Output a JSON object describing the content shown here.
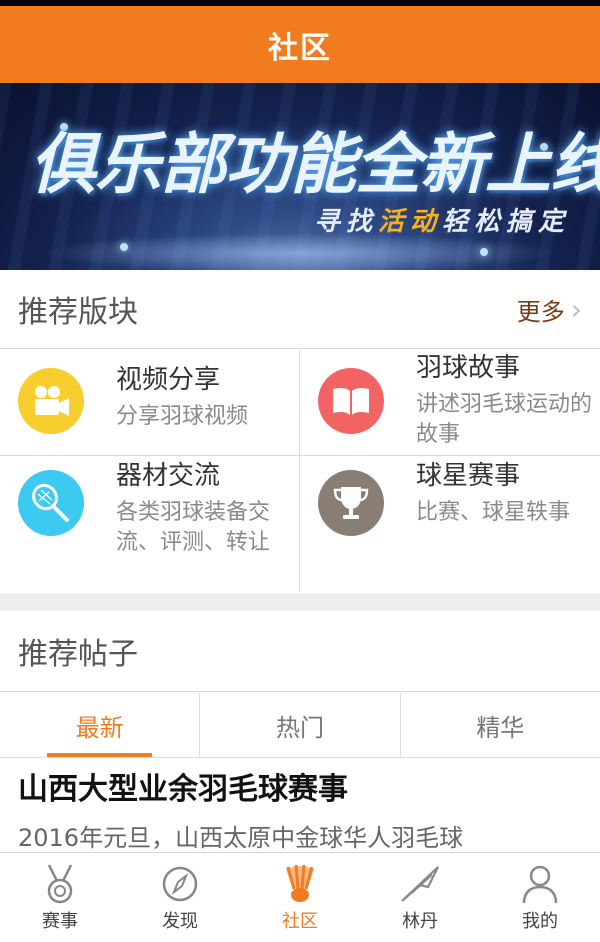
{
  "header": {
    "title": "社区"
  },
  "banner": {
    "headline": "俱乐部功能全新上线",
    "subline_a": "寻找",
    "subline_b": "活动",
    "subline_c": "轻松搞定"
  },
  "recommended_sections": {
    "title": "推荐版块",
    "more_label": "更多",
    "items": [
      {
        "name": "视频分享",
        "desc": "分享羽球视频",
        "icon": "video-camera-icon",
        "color": "#f8cd2e"
      },
      {
        "name": "羽球故事",
        "desc": "讲述羽毛球运动的故事",
        "icon": "book-icon",
        "color": "#f26363"
      },
      {
        "name": "器材交流",
        "desc": "各类羽球装备交流、评测、转让",
        "icon": "racket-icon",
        "color": "#3ccaf0"
      },
      {
        "name": "球星赛事",
        "desc": "比赛、球星轶事",
        "icon": "trophy-icon",
        "color": "#8a7d74"
      }
    ]
  },
  "recommended_posts": {
    "title": "推荐帖子",
    "tabs": [
      {
        "label": "最新",
        "active": true
      },
      {
        "label": "热门",
        "active": false
      },
      {
        "label": "精华",
        "active": false
      }
    ],
    "posts": [
      {
        "title": "山西大型业余羽毛球赛事",
        "excerpt": "2016年元旦，山西太原中金球华人羽毛球"
      }
    ]
  },
  "bottom_nav": {
    "items": [
      {
        "label": "赛事",
        "icon": "medal-icon",
        "active": false
      },
      {
        "label": "发现",
        "icon": "compass-icon",
        "active": false
      },
      {
        "label": "社区",
        "icon": "shuttlecock-icon",
        "active": true
      },
      {
        "label": "林丹",
        "icon": "player-logo-icon",
        "active": false
      },
      {
        "label": "我的",
        "icon": "user-icon",
        "active": false
      }
    ]
  },
  "colors": {
    "accent": "#f07c1f"
  }
}
